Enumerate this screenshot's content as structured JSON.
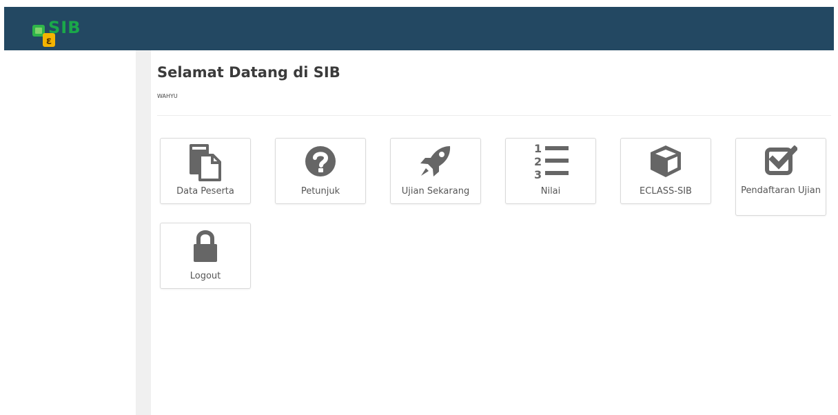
{
  "header": {
    "logo_text": "SIB",
    "logo_badge": "ε",
    "colors": {
      "bar": "#234862",
      "logo_green": "#1aa84a",
      "logo_yellow": "#f2b705"
    }
  },
  "main": {
    "title": "Selamat Datang di SIB",
    "user": "WAHYU"
  },
  "menu": [
    {
      "label": "Data Peserta",
      "icon": "file-copy-icon"
    },
    {
      "label": "Petunjuk",
      "icon": "question-circle-icon"
    },
    {
      "label": "Ujian Sekarang",
      "icon": "rocket-icon"
    },
    {
      "label": "Nilai",
      "icon": "ordered-list-icon"
    },
    {
      "label": "ECLASS-SIB",
      "icon": "cube-icon"
    },
    {
      "label": "Pendaftaran Ujian",
      "icon": "checkbox-icon"
    },
    {
      "label": "Logout",
      "icon": "lock-icon"
    }
  ]
}
